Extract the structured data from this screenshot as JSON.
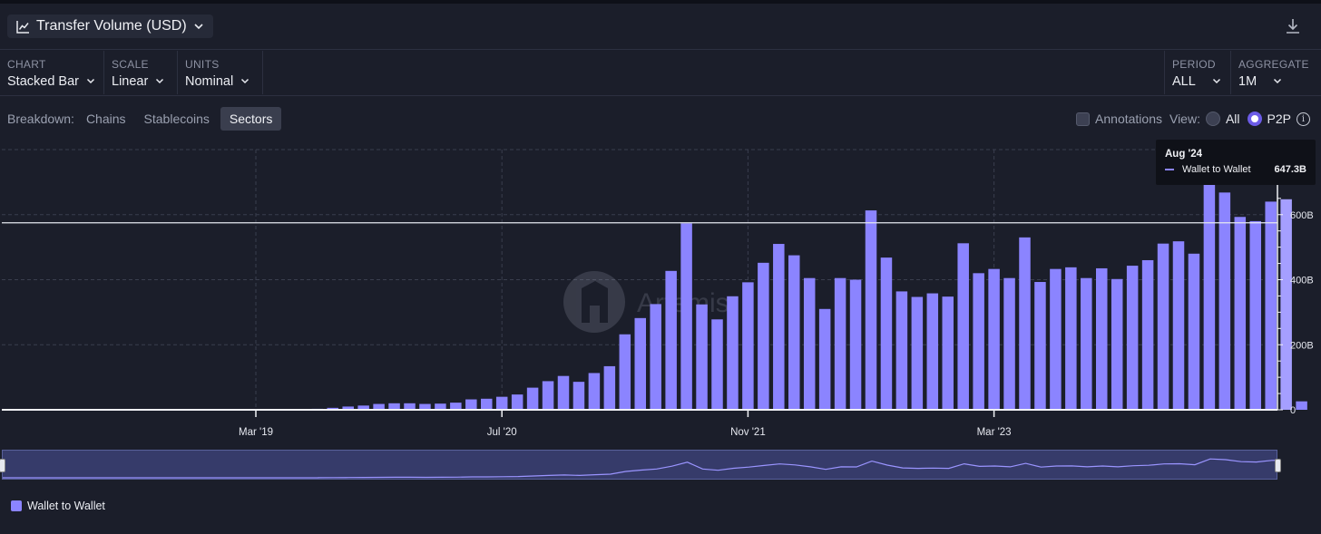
{
  "header": {
    "title": "Transfer Volume (USD)",
    "icon": "line-chart-icon",
    "download_icon": "download-icon"
  },
  "controls": {
    "chart": {
      "label": "CHART",
      "value": "Stacked Bar"
    },
    "scale": {
      "label": "SCALE",
      "value": "Linear"
    },
    "units": {
      "label": "UNITS",
      "value": "Nominal"
    },
    "period": {
      "label": "PERIOD",
      "value": "ALL"
    },
    "aggregate": {
      "label": "AGGREGATE",
      "value": "1M"
    }
  },
  "breakdown": {
    "label": "Breakdown:",
    "tabs": [
      "Chains",
      "Stablecoins",
      "Sectors"
    ],
    "active": "Sectors"
  },
  "options": {
    "annotations_label": "Annotations",
    "view_label": "View:",
    "view_all": "All",
    "view_p2p": "P2P",
    "selected_view": "P2P"
  },
  "tooltip": {
    "date": "Aug '24",
    "series": "Wallet to Wallet",
    "value": "647.3B"
  },
  "watermark": "Artemis",
  "legend": {
    "label": "Wallet to Wallet"
  },
  "colors": {
    "bar": "#8b84ff",
    "bar_highlight": "#a59fff",
    "background": "#1b1e2a"
  },
  "chart_data": {
    "type": "bar",
    "stacked": true,
    "y_unit": "B (USD)",
    "ylim": [
      0,
      800
    ],
    "y_ticks": [
      0,
      200,
      400,
      600
    ],
    "y_tick_labels": [
      "0",
      "200B",
      "400B",
      "600B"
    ],
    "x_tick_labels": [
      "Mar '19",
      "Jul '20",
      "Nov '21",
      "Mar '23"
    ],
    "x_tick_months": [
      0,
      16,
      32,
      48
    ],
    "first_bar_month": 4,
    "grid": true,
    "legend_position": "bottom-left",
    "series": [
      {
        "name": "Wallet to Wallet",
        "values": [
          3,
          6,
          10,
          13,
          18,
          20,
          20,
          18,
          19,
          22,
          32,
          34,
          40,
          47,
          68,
          88,
          104,
          86,
          113,
          134,
          232,
          282,
          325,
          427,
          573,
          324,
          278,
          349,
          392,
          452,
          510,
          475,
          405,
          310,
          405,
          400,
          613,
          468,
          364,
          347,
          358,
          348,
          512,
          420,
          433,
          405,
          530,
          393,
          433,
          438,
          405,
          435,
          402,
          443,
          460,
          511,
          518,
          480,
          692,
          668,
          593,
          580,
          640,
          647.3,
          26
        ]
      }
    ],
    "highlight_index": 63,
    "reference_line": 575
  }
}
